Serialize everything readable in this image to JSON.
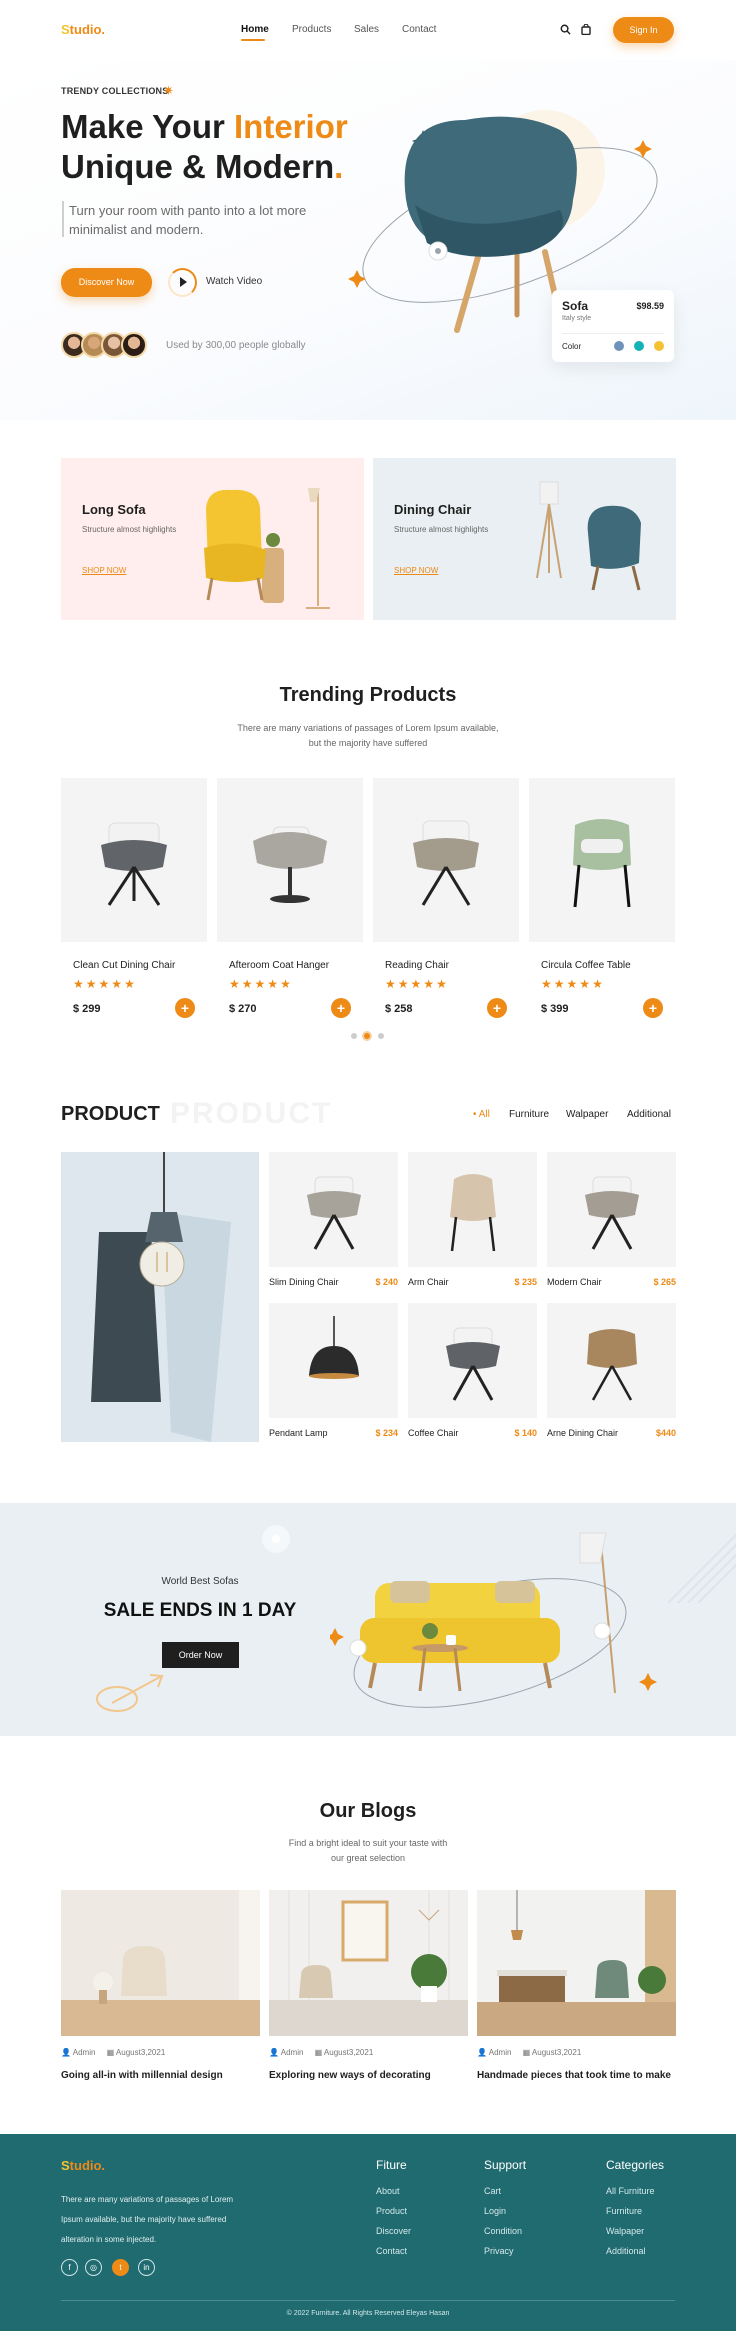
{
  "nav": {
    "logo_s": "S",
    "logo_rest": "tudio.",
    "links": [
      "Home",
      "Products",
      "Sales",
      "Contact"
    ],
    "signin": "Sign In"
  },
  "hero": {
    "tag": "TRENDY COLLECTIONS",
    "title_1": "Make Your ",
    "title_accent": "Interior",
    "title_2": "Unique & Modern",
    "title_dot": ".",
    "subtitle": "Turn your room with panto into a lot more minimalist and modern.",
    "discover": "Discover Now",
    "watch": "Watch Video",
    "used_by": "Used by 300,00 people globally",
    "product_card": {
      "name": "Sofa",
      "price": "$98.59",
      "style": "Italy style",
      "color_label": "Color",
      "colors": [
        "#6f93b8",
        "#14b3b8",
        "#f2c230"
      ]
    }
  },
  "promos": [
    {
      "title": "Long Sofa",
      "text": "Structure almost highlights",
      "link": "SHOP NOW"
    },
    {
      "title": "Dining Chair",
      "text": "Structure almost highlights",
      "link": "SHOP NOW"
    }
  ],
  "trending": {
    "title": "Trending Products",
    "subtitle_1": "There are many variations of passages of Lorem Ipsum available,",
    "subtitle_2": "but the majority have suffered",
    "items": [
      {
        "name": "Clean Cut Dining Chair",
        "price": "$ 299",
        "rating": 5
      },
      {
        "name": "Afteroom Coat Hanger",
        "price": "$ 270",
        "rating": 5
      },
      {
        "name": "Reading Chair",
        "price": "$ 258",
        "rating": 5
      },
      {
        "name": "Circula Coffee Table",
        "price": "$ 399",
        "rating": 5
      }
    ]
  },
  "product": {
    "title": "PRODUCT",
    "ghost": "PRODUCT",
    "filters": [
      "All",
      "Furniture",
      "Walpaper",
      "Additional"
    ],
    "items": [
      {
        "name": "Slim Dining Chair",
        "price": "$ 240"
      },
      {
        "name": "Arm Chair",
        "price": "$ 235"
      },
      {
        "name": "Modern Chair",
        "price": "$ 265"
      },
      {
        "name": "Pendant Lamp",
        "price": "$ 234"
      },
      {
        "name": "Coffee Chair",
        "price": "$ 140"
      },
      {
        "name": "Arne Dining Chair",
        "price": "$440"
      }
    ]
  },
  "sale": {
    "kicker": "World Best Sofas",
    "title": "SALE ENDS IN 1 DAY",
    "button": "Order Now"
  },
  "blogs": {
    "title": "Our Blogs",
    "subtitle_1": "Find a bright ideal to suit your taste with",
    "subtitle_2": "our great selection",
    "items": [
      {
        "author": "Admin",
        "date": "August3,2021",
        "title": "Going all-in with millennial design"
      },
      {
        "author": "Admin",
        "date": "August3,2021",
        "title": "Exploring new ways of decorating"
      },
      {
        "author": "Admin",
        "date": "August3,2021",
        "title": "Handmade pieces that took time to make"
      }
    ]
  },
  "footer": {
    "logo_s": "S",
    "logo_rest": "tudio.",
    "about_1": "There are many variations of passages of Lorem",
    "about_2": "Ipsum available, but the majority have suffered",
    "about_3": "alteration in some injected.",
    "socials": [
      "f",
      "◎",
      "t",
      "in"
    ],
    "col1": {
      "title": "Fiture",
      "links": [
        "About",
        "Product",
        "Discover",
        "Contact"
      ]
    },
    "col2": {
      "title": "Support",
      "links": [
        "Cart",
        "Login",
        "Condition",
        "Privacy"
      ]
    },
    "col3": {
      "title": "Categories",
      "links": [
        "All Furniture",
        "Furniture",
        "Walpaper",
        "Additional"
      ]
    },
    "copyright": "© 2022 Furniture. All Rights Reserved Eleyas Hasan"
  },
  "colors": {
    "accent": "#ee8a16",
    "footer": "#1f6b70",
    "promo1": "#ffeeed",
    "promo2": "#e9eff2",
    "sale_bg": "#e9eff3"
  }
}
